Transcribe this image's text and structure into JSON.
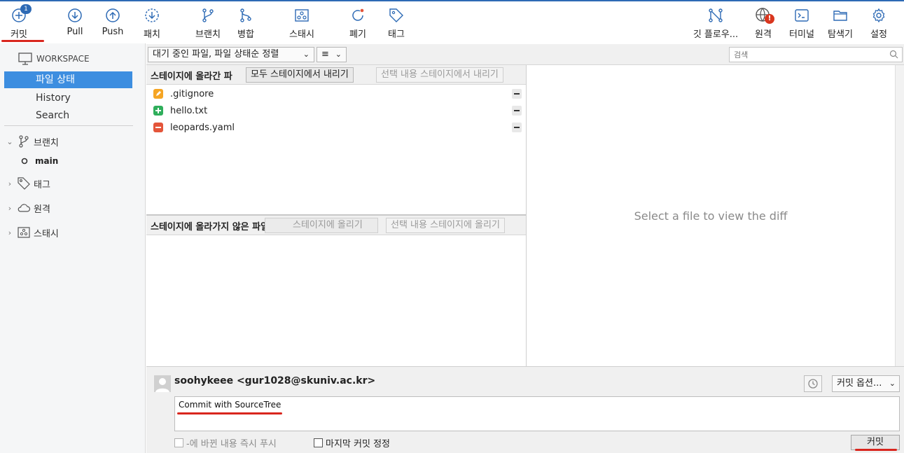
{
  "toolbar": {
    "commit": {
      "label": "커밋",
      "badge": "1",
      "icon": "plus-circle-icon"
    },
    "pull": {
      "label": "Pull",
      "icon": "arrow-down-circle-icon"
    },
    "push": {
      "label": "Push",
      "icon": "arrow-up-circle-icon"
    },
    "fetch": {
      "label": "패치",
      "icon": "dashed-arrow-down-circle-icon"
    },
    "branch": {
      "label": "브랜치",
      "icon": "branch-icon"
    },
    "merge": {
      "label": "병합",
      "icon": "merge-icon"
    },
    "stash": {
      "label": "스태시",
      "icon": "stash-icon"
    },
    "discard": {
      "label": "폐기",
      "icon": "discard-icon"
    },
    "tag": {
      "label": "태그",
      "icon": "tag-icon"
    },
    "gitflow": {
      "label": "깃 플로우...",
      "icon": "git-flow-icon"
    },
    "remote": {
      "label": "원격",
      "alert": "!",
      "icon": "globe-icon"
    },
    "terminal": {
      "label": "터미널",
      "icon": "terminal-icon"
    },
    "explorer": {
      "label": "탐색기",
      "icon": "folder-icon"
    },
    "settings": {
      "label": "설정",
      "icon": "gear-icon"
    }
  },
  "sidebar": {
    "workspace_label": "WORKSPACE",
    "workspace_items": [
      "파일 상태",
      "History",
      "Search"
    ],
    "branches_label": "브랜치",
    "current_branch": "main",
    "tags_label": "태그",
    "remotes_label": "원격",
    "stashes_label": "스태시"
  },
  "filter": {
    "file_filter": "대기 중인 파일, 파일 상태순 정렬",
    "view_mode": "≡",
    "search_placeholder": "검색"
  },
  "staged": {
    "title": "스테이지에 올라간 파",
    "unstage_all": "모두 스테이지에서 내리기",
    "unstage_selected": "선택 내용 스테이지에서 내리기",
    "files": [
      {
        "name": ".gitignore",
        "status": "modified"
      },
      {
        "name": "hello.txt",
        "status": "added"
      },
      {
        "name": "leopards.yaml",
        "status": "removed"
      }
    ]
  },
  "unstaged": {
    "title": "스테이지에 올라가지 않은 파일",
    "stage_all": "모두 스테이지에 올리기",
    "stage_all_visible": "스테이지에 올리기",
    "stage_selected": "선택 내용 스테이지에 올리기"
  },
  "diff": {
    "empty_message": "Select a file to view the diff"
  },
  "commit": {
    "author": "soohykeee <gur1028@skuniv.ac.kr>",
    "options_label": "커밋 옵션...",
    "message": "Commit with SourceTree",
    "push_immediately": "-에 바뀐 내용 즉시 푸시",
    "amend": "마지막 커밋 정정",
    "commit_button": "커밋"
  },
  "colors": {
    "accent": "#2d6ab5",
    "selection": "#3d8ee0",
    "annotation_red": "#d9261e"
  }
}
